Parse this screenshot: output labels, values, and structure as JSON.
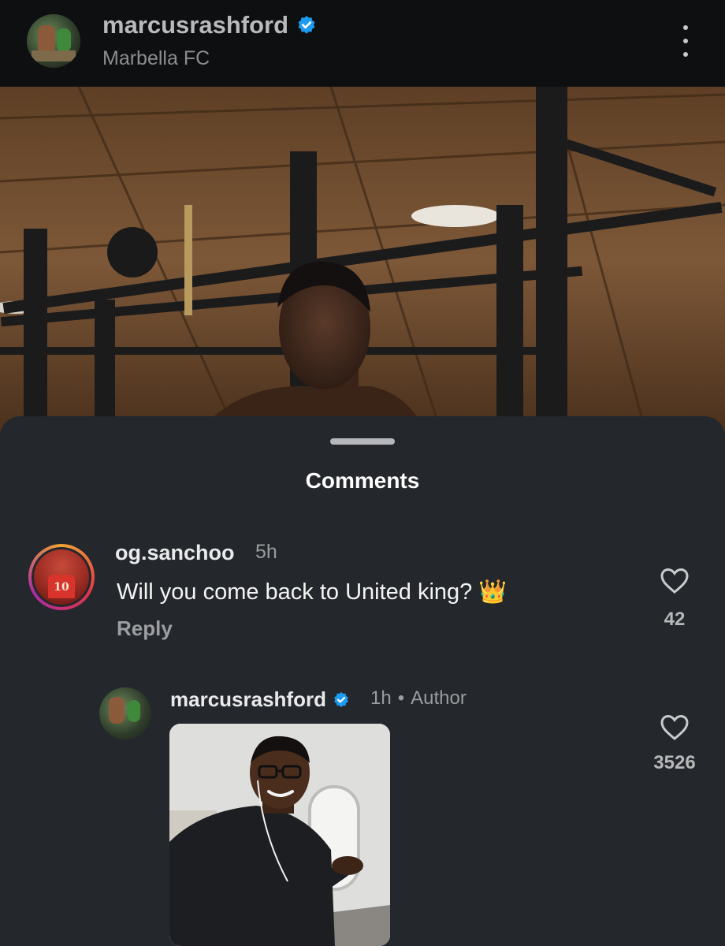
{
  "header": {
    "username": "marcusrashford",
    "subtitle": "Marbella FC",
    "verified": true,
    "more_icon": "more-vertical-icon"
  },
  "sheet": {
    "title": "Comments"
  },
  "comments": [
    {
      "username": "og.sanchoo",
      "time": "5h",
      "text": "Will you come back to United king? 👑",
      "reply_label": "Reply",
      "likes": "42",
      "avatar_number": "10"
    },
    {
      "username": "marcusrashford",
      "verified": true,
      "time": "1h",
      "separator": "•",
      "role": "Author",
      "likes": "3526",
      "attachment": "image"
    }
  ],
  "colors": {
    "verified_blue": "#1d9bf0",
    "sheet_bg": "#24272b",
    "header_bg": "#0d0f11"
  }
}
